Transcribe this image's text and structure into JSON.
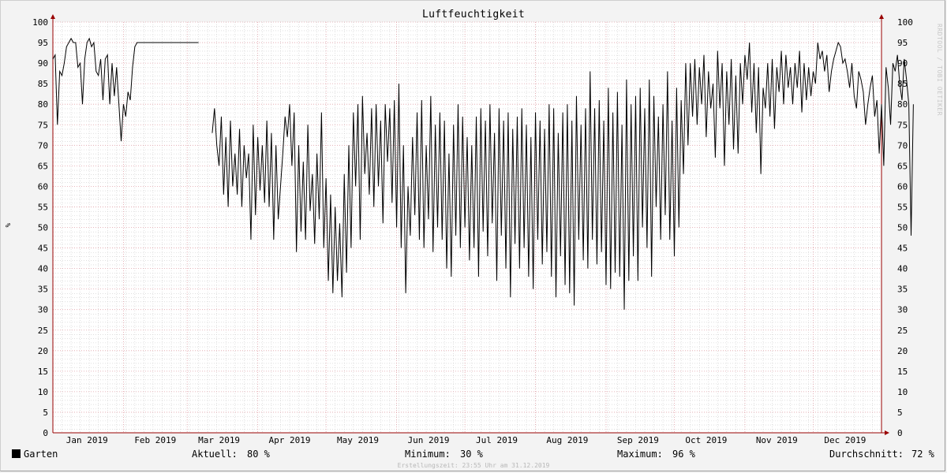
{
  "title": "Luftfeuchtigkeit",
  "watermark": "RRDTOOL / TOBI OETIKER",
  "unit_label": "%",
  "legend": {
    "series_name": "Garten",
    "current_label": "Aktuell:",
    "current_value": "80 %",
    "min_label": "Minimum:",
    "min_value": "30 %",
    "max_label": "Maximum:",
    "max_value": "96 %",
    "avg_label": "Durchschnitt:",
    "avg_value": "72 %"
  },
  "footer": "Erstellungszeit: 23:55 Uhr am 31.12.2019",
  "colors": {
    "background": "#f3f3f3",
    "canvas": "#ffffff",
    "major_grid": "#e0a0a8",
    "minor_grid": "#cccccc",
    "axis": "#990000",
    "line": "#000000"
  },
  "chart_data": {
    "type": "line",
    "title": "Luftfeuchtigkeit",
    "ylabel": "%",
    "ylim": [
      0,
      100
    ],
    "yticks": [
      0,
      5,
      10,
      15,
      20,
      25,
      30,
      35,
      40,
      45,
      50,
      55,
      60,
      65,
      70,
      75,
      80,
      85,
      90,
      95,
      100
    ],
    "xlim": [
      1,
      365
    ],
    "x_unit": "day of year 2019",
    "xtick_labels": [
      "Jan 2019",
      "Feb 2019",
      "Mar 2019",
      "Apr 2019",
      "May 2019",
      "Jun 2019",
      "Jul 2019",
      "Aug 2019",
      "Sep 2019",
      "Oct 2019",
      "Nov 2019",
      "Dec 2019"
    ],
    "xtick_days": [
      16,
      46,
      74,
      105,
      135,
      166,
      196,
      227,
      258,
      288,
      319,
      349
    ],
    "grid": true,
    "series": [
      {
        "name": "Garten",
        "color": "#000000",
        "segments": [
          {
            "start_day": 1,
            "values": [
              91,
              92,
              75,
              88,
              87,
              90,
              94,
              95,
              96,
              95,
              95,
              89,
              90,
              80,
              91,
              95,
              96,
              94,
              95,
              88,
              87,
              91,
              81,
              91,
              92,
              80,
              90,
              82,
              89,
              80,
              71,
              80,
              77,
              83,
              81,
              89,
              94,
              95,
              95,
              95,
              95,
              95,
              95,
              95,
              95,
              95,
              95,
              95,
              95,
              95,
              95,
              95,
              95,
              95,
              95,
              95,
              95,
              95,
              95,
              95,
              95,
              95,
              95,
              95,
              95
            ]
          },
          {
            "start_day": 71,
            "values": [
              73,
              79,
              70,
              65,
              77,
              58,
              72,
              55,
              76,
              60,
              68,
              58,
              74,
              55,
              70,
              62,
              68,
              47,
              75,
              53,
              72,
              59,
              70,
              56,
              76,
              55,
              73,
              47,
              70,
              52,
              60,
              68,
              77,
              72,
              80,
              65,
              78,
              44,
              70,
              49,
              66,
              47,
              75,
              54,
              63,
              46,
              68,
              52,
              78,
              45,
              62,
              37,
              58,
              34,
              55,
              37,
              51,
              33,
              63,
              39,
              70,
              45,
              78,
              60,
              80,
              47,
              82,
              63,
              73,
              58,
              79,
              55,
              80,
              60,
              76,
              51,
              80,
              66,
              79,
              56,
              81,
              50,
              85,
              45,
              70,
              34,
              60,
              48,
              72,
              53,
              78,
              47,
              81,
              45,
              70,
              52,
              82,
              44,
              75,
              50,
              78,
              47,
              76,
              40,
              68,
              38,
              75,
              48,
              80,
              45,
              77,
              50,
              72,
              42,
              70,
              45,
              77,
              38,
              79,
              49,
              76,
              43,
              80,
              51,
              73,
              37,
              79,
              48,
              76,
              40,
              78,
              33,
              74,
              46,
              77,
              40,
              79,
              45,
              75,
              38,
              72,
              35,
              78,
              47,
              76,
              41,
              74,
              44,
              80,
              38,
              79,
              33,
              73,
              43,
              78,
              36,
              80,
              34,
              76,
              31,
              82,
              47,
              75,
              42,
              79,
              40,
              88,
              47,
              79,
              41,
              81,
              44,
              76,
              36,
              84,
              35,
              78,
              39,
              83,
              38,
              75,
              30,
              86,
              37,
              80,
              43,
              82,
              37,
              84,
              50,
              79,
              45,
              86,
              38,
              82,
              55,
              77,
              47,
              80,
              53,
              88,
              47,
              76,
              43,
              84,
              50,
              81,
              63,
              90,
              70,
              90,
              77,
              91,
              75,
              89,
              80,
              92,
              72,
              88,
              79,
              85,
              67,
              93,
              79,
              90,
              65,
              88,
              75,
              91,
              69,
              87,
              68,
              90,
              80,
              92,
              86,
              95,
              78,
              90,
              73,
              89,
              63,
              84,
              79,
              90,
              77,
              91,
              74,
              89,
              83,
              93,
              80,
              92,
              84,
              89,
              80,
              90,
              84,
              93,
              78,
              90,
              81,
              89,
              82,
              88,
              85,
              95,
              91,
              93,
              88,
              92,
              83,
              88,
              91,
              93,
              95,
              94,
              90,
              91,
              88,
              84,
              90,
              82,
              79,
              88,
              86,
              83,
              75,
              80,
              84,
              87,
              77,
              81,
              68,
              80,
              65,
              89,
              84,
              75,
              90,
              88,
              92,
              85,
              81,
              91,
              86,
              80,
              48,
              80
            ]
          }
        ]
      }
    ]
  }
}
